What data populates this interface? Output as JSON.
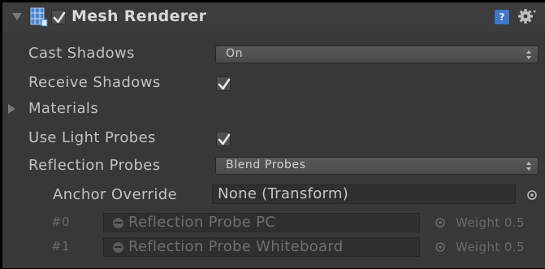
{
  "component": {
    "title": "Mesh Renderer",
    "enabled": true,
    "icons": {
      "header": "mesh-renderer-icon",
      "help": "help-icon",
      "settings": "gear-icon"
    },
    "help_glyph": "?"
  },
  "properties": {
    "cast_shadows": {
      "label": "Cast Shadows",
      "value": "On"
    },
    "receive_shadows": {
      "label": "Receive Shadows",
      "checked": true
    },
    "materials": {
      "label": "Materials",
      "expanded": false
    },
    "use_light_probes": {
      "label": "Use Light Probes",
      "checked": true
    },
    "reflection_probes": {
      "label": "Reflection Probes",
      "value": "Blend Probes"
    },
    "anchor_override": {
      "label": "Anchor Override",
      "value": "None (Transform)"
    }
  },
  "probe_list": [
    {
      "index": "#0",
      "name": "Reflection Probe PC",
      "weight": "Weight 0.5"
    },
    {
      "index": "#1",
      "name": "Reflection Probe Whiteboard",
      "weight": "Weight 0.5"
    }
  ],
  "colors": {
    "panel_bg": "#383838",
    "field_bg": "#2f2f2f",
    "text": "#c2c2c2",
    "dim_text": "#6b6b6b",
    "accent": "#3f78c8"
  }
}
